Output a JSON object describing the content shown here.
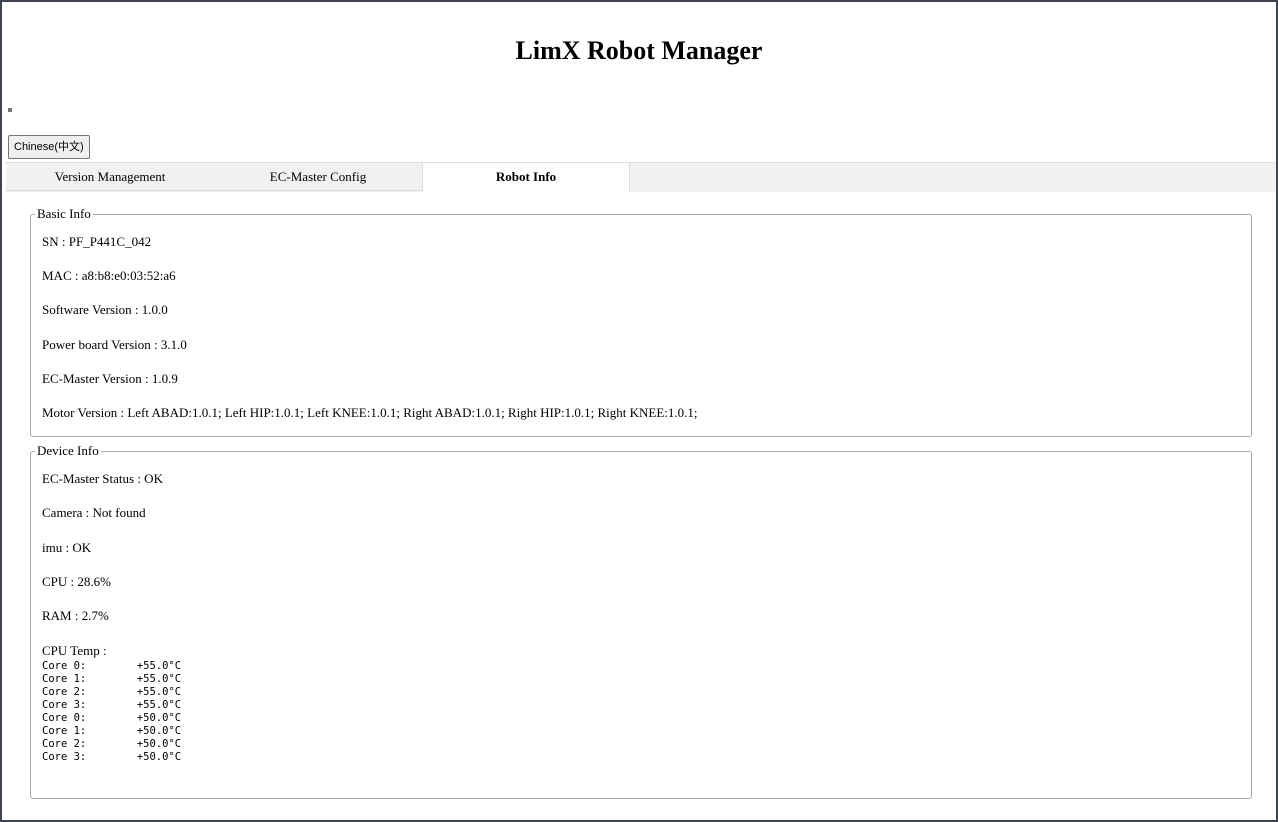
{
  "header": {
    "title": "LimX Robot Manager"
  },
  "language_button": "Chinese(中文)",
  "tabs": [
    {
      "label": "Version Management",
      "active": false
    },
    {
      "label": "EC-Master Config",
      "active": false
    },
    {
      "label": "Robot Info",
      "active": true
    }
  ],
  "basic_info": {
    "legend": "Basic Info",
    "rows": [
      "SN : PF_P441C_042",
      "MAC : a8:b8:e0:03:52:a6",
      "Software Version : 1.0.0",
      "Power board Version : 3.1.0",
      "EC-Master Version : 1.0.9",
      "Motor Version : Left ABAD:1.0.1; Left HIP:1.0.1; Left KNEE:1.0.1; Right ABAD:1.0.1; Right HIP:1.0.1; Right KNEE:1.0.1;"
    ]
  },
  "device_info": {
    "legend": "Device Info",
    "rows": [
      "EC-Master Status : OK",
      "Camera : Not found",
      "imu : OK",
      "CPU : 28.6%",
      "RAM : 2.7%",
      "CPU Temp :"
    ],
    "cpu_temp_output": "Core 0:        +55.0°C\nCore 1:        +55.0°C\nCore 2:        +55.0°C\nCore 3:        +55.0°C\nCore 0:        +50.0°C\nCore 1:        +50.0°C\nCore 2:        +50.0°C\nCore 3:        +50.0°C"
  }
}
